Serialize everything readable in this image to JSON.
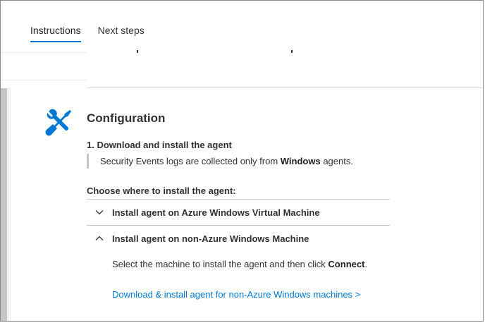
{
  "tabs": [
    {
      "label": "Instructions",
      "active": true
    },
    {
      "label": "Next steps",
      "active": false
    }
  ],
  "section": {
    "icon": "tools-icon",
    "title": "Configuration"
  },
  "step1": {
    "title": "1. Download and install the agent",
    "note_prefix": "Security Events logs are collected only from ",
    "note_bold": "Windows",
    "note_suffix": " agents."
  },
  "choose_label": "Choose where to install the agent:",
  "accordion": [
    {
      "label": "Install agent on Azure Windows Virtual Machine",
      "expanded": false,
      "icon": "chevron-down-icon"
    },
    {
      "label": "Install agent on non-Azure Windows Machine",
      "expanded": true,
      "icon": "chevron-up-icon"
    }
  ],
  "expanded_content": {
    "text_prefix": "Select the machine to install the agent and then click ",
    "text_bold": "Connect",
    "text_suffix": ".",
    "link": "Download & install agent for non-Azure Windows machines >"
  },
  "colors": {
    "accent": "#0078d4",
    "tool_icon": "#0078d4"
  }
}
